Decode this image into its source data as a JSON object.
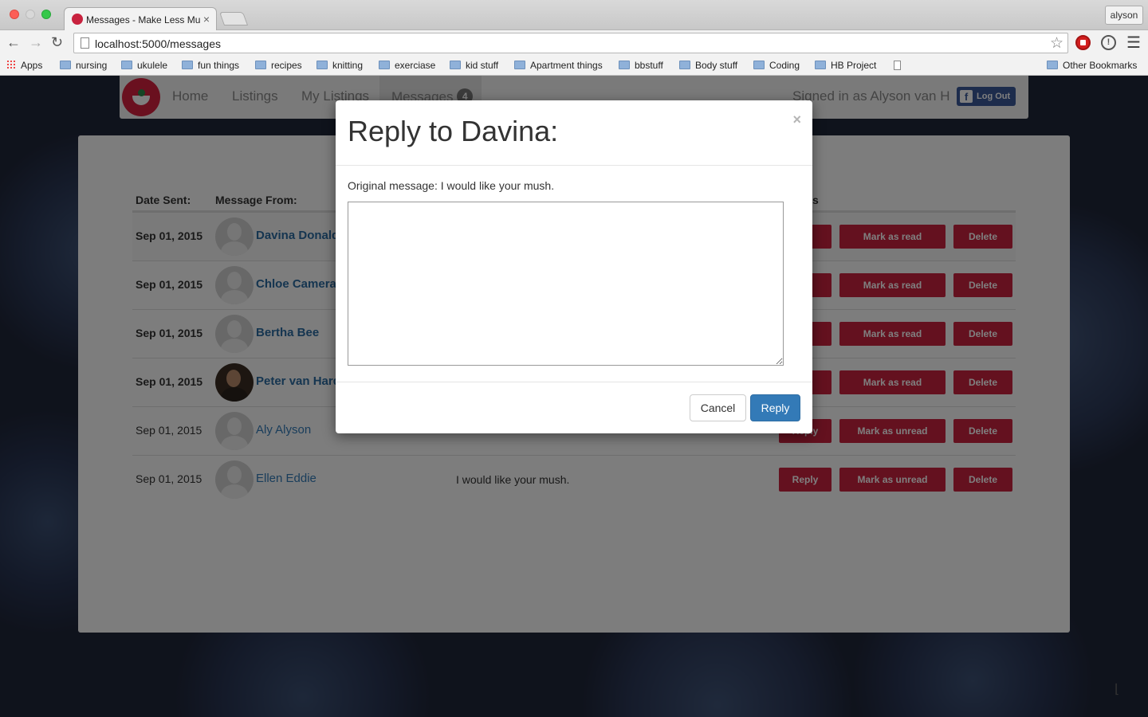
{
  "browser": {
    "tab_title": "Messages - Make Less Mu",
    "tab_close": "×",
    "profile": "alyson",
    "url": "localhost:5000/messages",
    "bookmarks": [
      "Apps",
      "nursing",
      "ukulele",
      "fun things",
      "recipes",
      "knitting",
      "exerciase",
      "kid stuff",
      "Apartment things",
      "bbstuff",
      "Body stuff",
      "Coding",
      "HB Project"
    ],
    "other_bookmarks": "Other Bookmarks"
  },
  "navbar": {
    "links": [
      "Home",
      "Listings",
      "My Listings",
      "Messages"
    ],
    "message_count": "4",
    "signed_in": "Signed in as Alyson van H",
    "logout": "Log Out"
  },
  "table": {
    "headers": [
      "Date Sent:",
      "Message From:",
      "s"
    ],
    "rows": [
      {
        "date": "Sep 01, 2015",
        "from": "Davina Donald",
        "message": "",
        "reply": "y",
        "mark": "Mark as read",
        "delete": "Delete"
      },
      {
        "date": "Sep 01, 2015",
        "from": "Chloe Camera",
        "message": "",
        "reply": "y",
        "mark": "Mark as read",
        "delete": "Delete"
      },
      {
        "date": "Sep 01, 2015",
        "from": "Bertha Bee",
        "message": "",
        "reply": "y",
        "mark": "Mark as read",
        "delete": "Delete"
      },
      {
        "date": "Sep 01, 2015",
        "from": "Peter van Hard",
        "message": "",
        "reply": "y",
        "mark": "Mark as read",
        "delete": "Delete"
      },
      {
        "date": "Sep 01, 2015",
        "from": "Aly Alyson",
        "message": "",
        "reply": "Reply",
        "mark": "Mark as unread",
        "delete": "Delete"
      },
      {
        "date": "Sep 01, 2015",
        "from": "Ellen Eddie",
        "message": "I would like your mush.",
        "reply": "Reply",
        "mark": "Mark as unread",
        "delete": "Delete"
      }
    ]
  },
  "modal": {
    "title": "Reply to Davina:",
    "close": "×",
    "original": "Original message: I would like your mush.",
    "reply_value": "",
    "cancel": "Cancel",
    "submit": "Reply"
  },
  "colors": {
    "accent_red": "#c8223e",
    "primary_blue": "#337ab7",
    "facebook": "#3b5998"
  }
}
